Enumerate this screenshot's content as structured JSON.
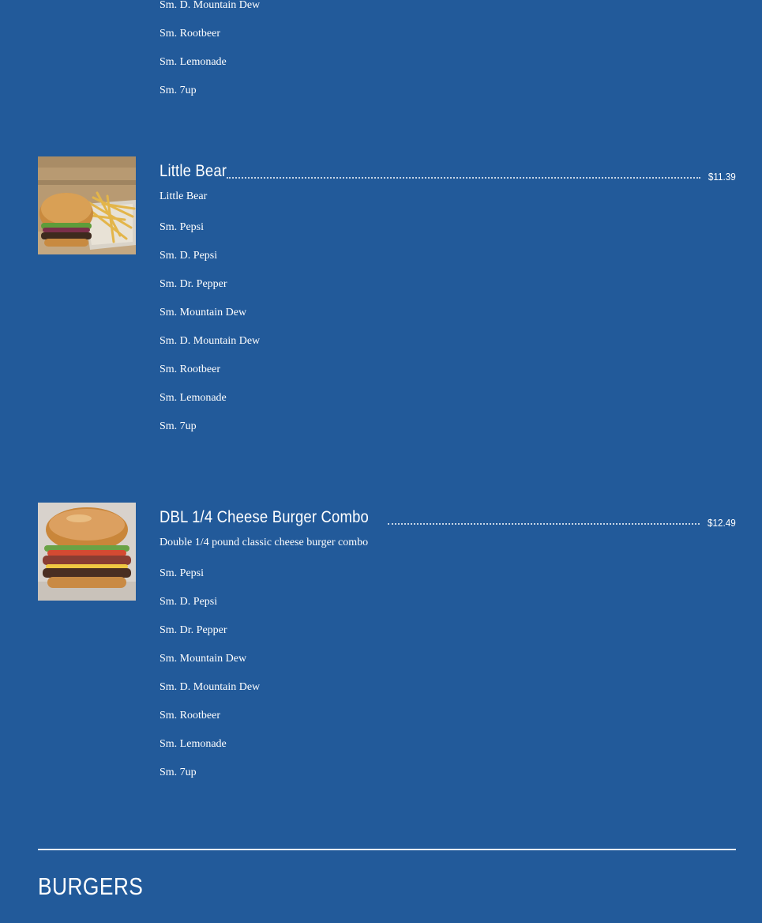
{
  "previous_item": {
    "options": [
      "Sm. D. Mountain Dew",
      "Sm. Rootbeer",
      "Sm. Lemonade",
      "Sm. 7up"
    ]
  },
  "items": [
    {
      "title": "Little Bear",
      "price": "$11.39",
      "description": "Little Bear",
      "image": "burger-with-fries-photo",
      "options": [
        "Sm. Pepsi",
        "Sm. D. Pepsi",
        "Sm. Dr. Pepper",
        "Sm. Mountain Dew",
        "Sm. D. Mountain Dew",
        "Sm. Rootbeer",
        "Sm. Lemonade",
        "Sm. 7up"
      ]
    },
    {
      "title": "DBL 1/4 Cheese Burger Combo",
      "price": "$12.49",
      "description": "Double 1/4 pound classic cheese burger combo",
      "image": "double-cheese-burger-photo",
      "options": [
        "Sm. Pepsi",
        "Sm. D. Pepsi",
        "Sm. Dr. Pepper",
        "Sm. Mountain Dew",
        "Sm. D. Mountain Dew",
        "Sm. Rootbeer",
        "Sm. Lemonade",
        "Sm. 7up"
      ]
    }
  ],
  "next_section": {
    "title": "BURGERS"
  },
  "colors": {
    "background": "#225a9a",
    "text": "#ffffff"
  }
}
